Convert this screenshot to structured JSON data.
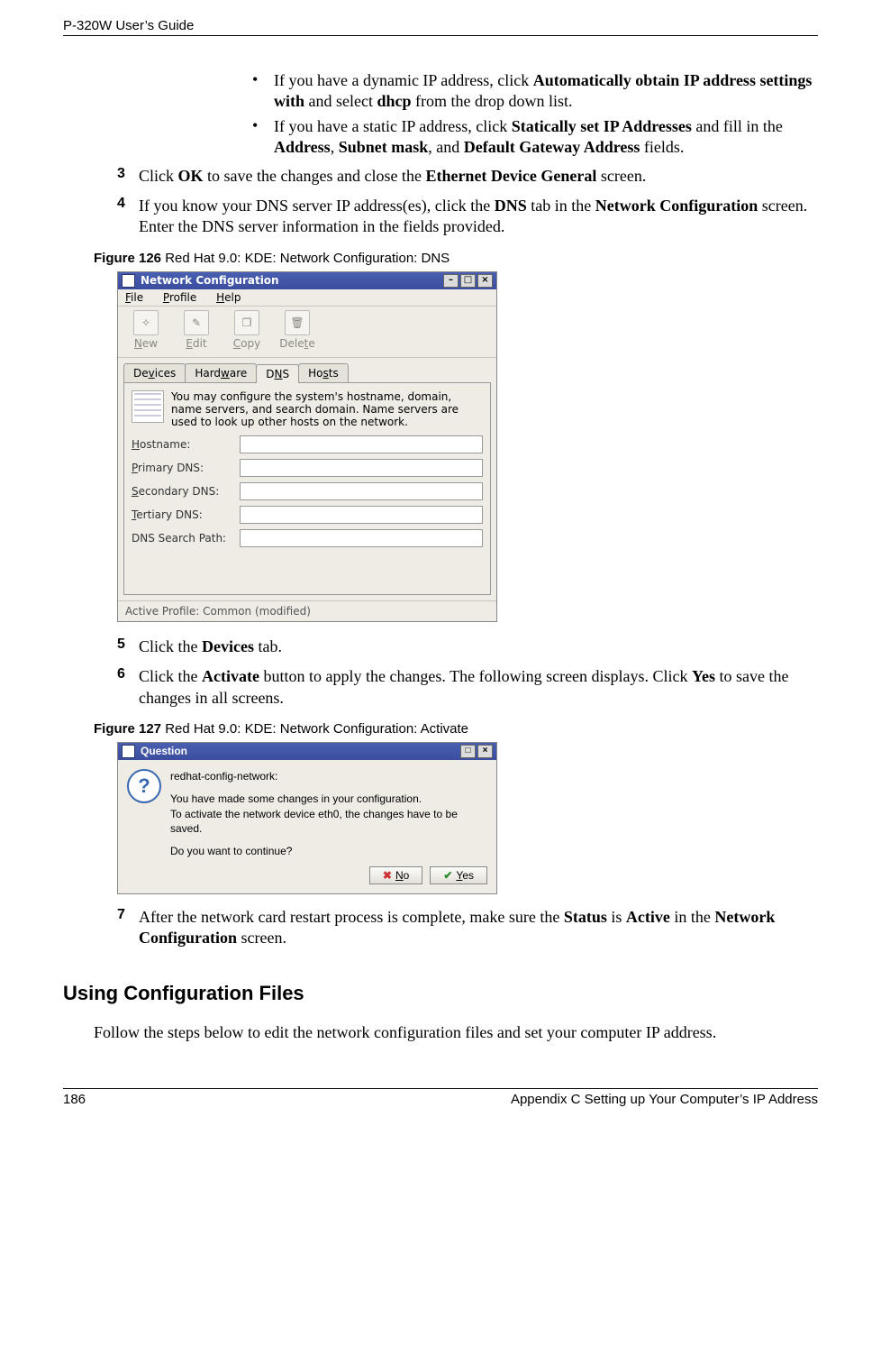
{
  "header": {
    "left": "P-320W User’s Guide"
  },
  "bullets": [
    {
      "pre": "If you have a dynamic IP address, click ",
      "b1": "Automatically obtain IP address settings with",
      "mid1": " and select ",
      "b2": "dhcp",
      "post": " from the drop down list."
    },
    {
      "pre": "If you have a static IP address, click ",
      "b1": "Statically set IP Addresses",
      "mid1": " and fill in the  ",
      "b2": "Address",
      "sep1": ", ",
      "b3": "Subnet mask",
      "sep2": ", and ",
      "b4": "Default Gateway Address",
      "post": " fields."
    }
  ],
  "steps3": {
    "num": "3",
    "pre": "Click ",
    "b1": "OK",
    "mid1": " to save the changes and close the ",
    "b2": "Ethernet Device General",
    "post": " screen."
  },
  "steps4": {
    "num": "4",
    "pre": "If you know your DNS server IP address(es), click the ",
    "b1": "DNS",
    "mid1": " tab in the ",
    "b2": "Network Configuration",
    "post": " screen. Enter the DNS server information in the fields provided."
  },
  "fig126": {
    "label": "Figure 126",
    "caption": "   Red Hat 9.0: KDE: Network Configuration: DNS"
  },
  "nc": {
    "title": "Network Configuration",
    "menus": {
      "file": "File",
      "profile": "Profile",
      "help": "Help"
    },
    "tools": {
      "new": "New",
      "edit": "Edit",
      "copy": "Copy",
      "delete": "Delete"
    },
    "tabs": {
      "devices": "Devices",
      "hardware": "Hardware",
      "dns": "DNS",
      "hosts": "Hosts"
    },
    "desc": "You may configure the system's hostname, domain, name servers, and search domain. Name servers are used to look up other hosts on the network.",
    "fields": {
      "hostname": "Hostname:",
      "primary": "Primary DNS:",
      "secondary": "Secondary DNS:",
      "tertiary": "Tertiary DNS:",
      "search": "DNS Search Path:"
    },
    "status": "Active Profile: Common (modified)"
  },
  "steps5": {
    "num": "5",
    "pre": "Click the ",
    "b1": "Devices",
    "post": " tab."
  },
  "steps6": {
    "num": "6",
    "pre": "Click the ",
    "b1": "Activate",
    "mid1": " button to apply the changes. The following screen displays. Click ",
    "b2": "Yes",
    "post": " to save the changes in all screens."
  },
  "fig127": {
    "label": "Figure 127",
    "caption": "   Red Hat 9.0: KDE: Network Configuration: Activate "
  },
  "dlg": {
    "title": "Question",
    "l1": "redhat-config-network:",
    "l2": "You have made some changes in your configuration.",
    "l3": "To activate the network device eth0, the changes have to be saved.",
    "l4": "Do you want to continue?",
    "no": "No",
    "yes": "Yes"
  },
  "steps7": {
    "num": "7",
    "pre": "After the network card restart process is complete, make sure the ",
    "b1": "Status",
    "mid1": " is ",
    "b2": "Active",
    "mid2": " in the ",
    "b3": "Network Configuration",
    "post": " screen."
  },
  "h2": "Using Configuration Files",
  "body2": "Follow the steps below to edit the network configuration files and set your computer IP address.",
  "footer": {
    "left": "186",
    "right": "Appendix C Setting up Your Computer’s IP Address"
  }
}
